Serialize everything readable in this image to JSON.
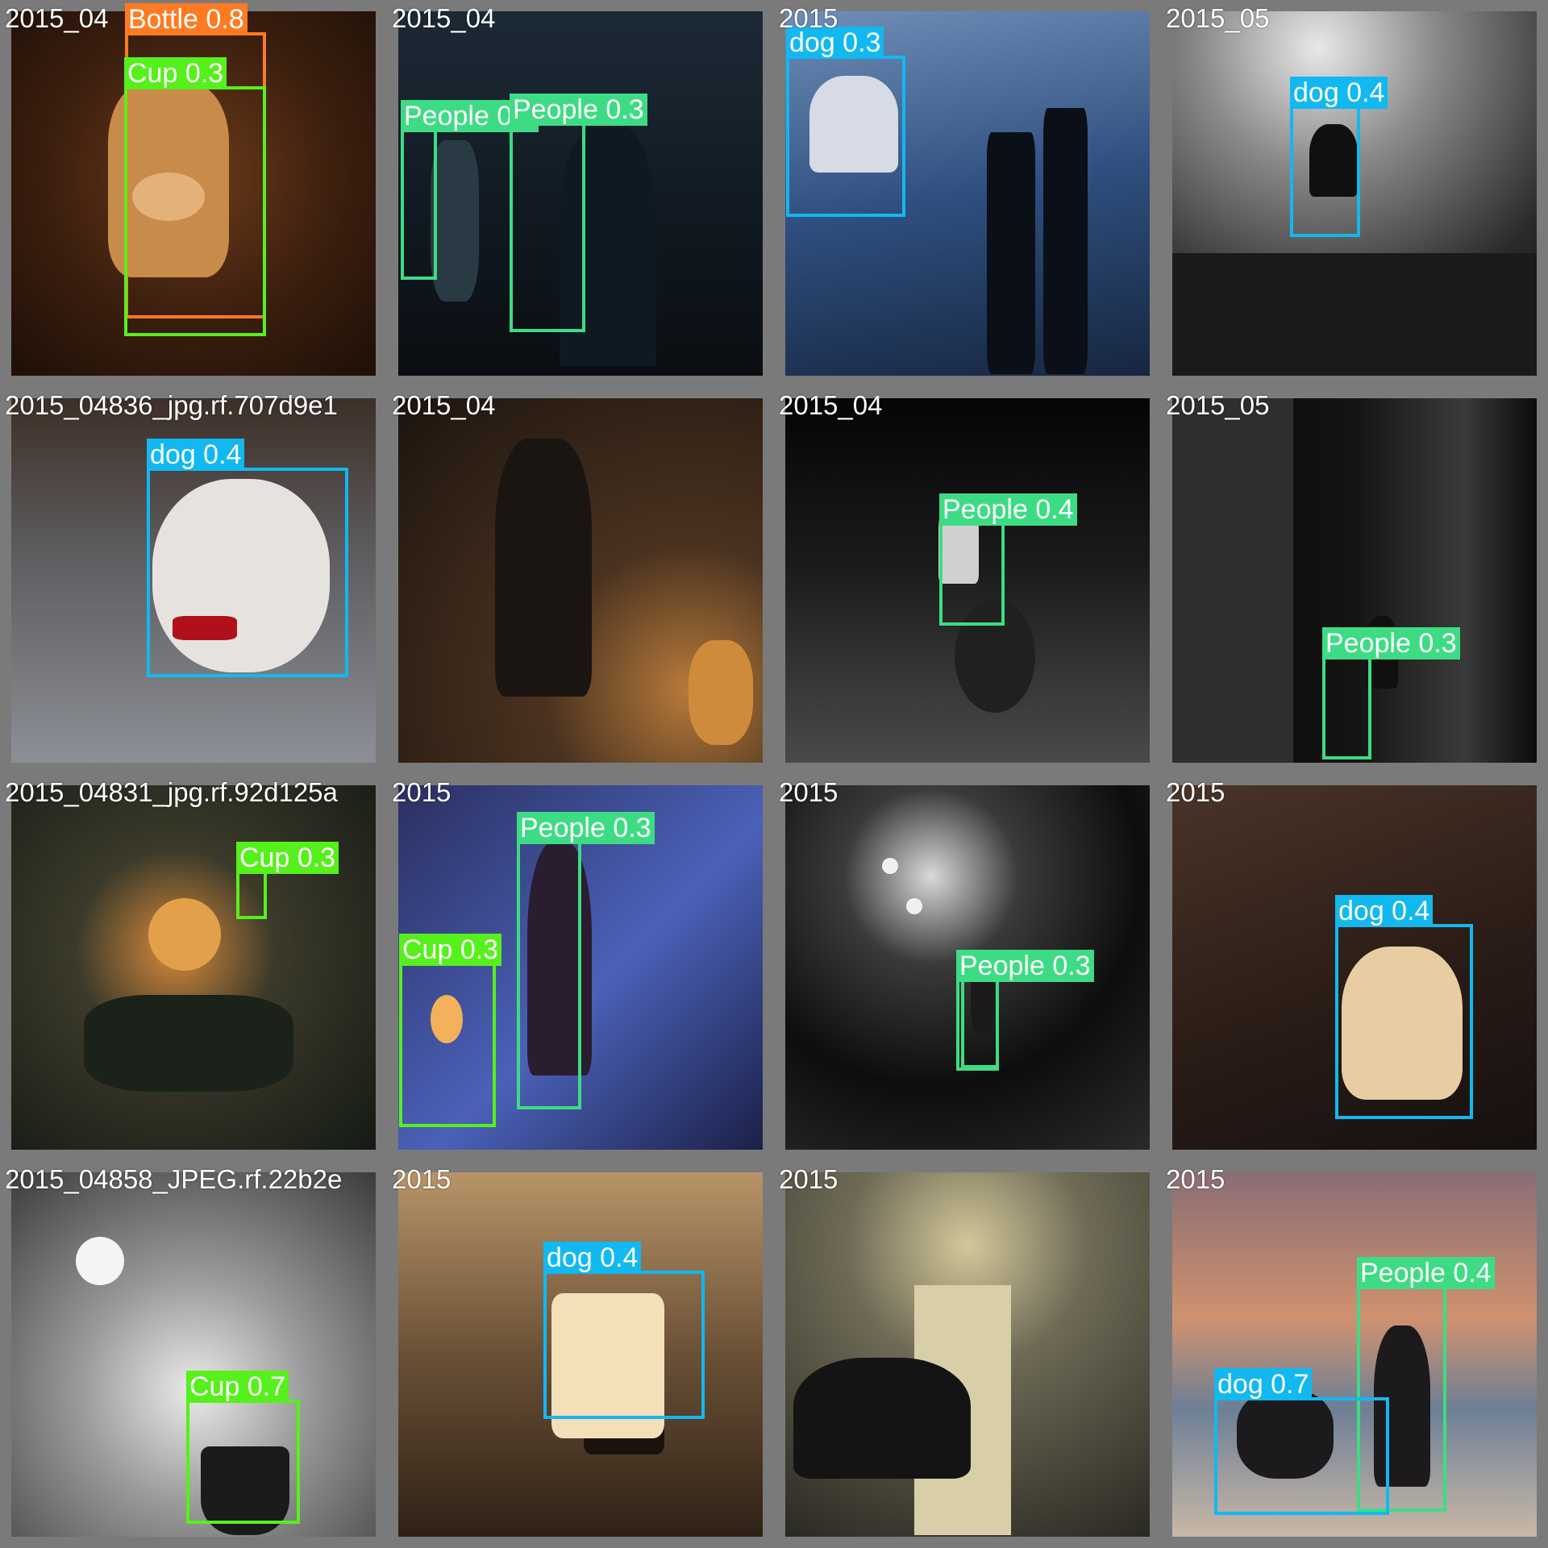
{
  "cells": [
    {
      "filename": "2015_04",
      "detections": [
        {
          "label": "Bottle 0.8",
          "cls": "bottle"
        },
        {
          "label": "Cup 0.3",
          "cls": "cup"
        }
      ]
    },
    {
      "filename": "2015_04",
      "detections": [
        {
          "label": "People 0.3",
          "cls": "people"
        },
        {
          "label": "People 0.3",
          "cls": "people"
        }
      ]
    },
    {
      "filename": "2015",
      "detections": [
        {
          "label": "dog 0.3",
          "cls": "dog"
        }
      ]
    },
    {
      "filename": "2015_05",
      "detections": [
        {
          "label": "dog 0.4",
          "cls": "dog"
        }
      ]
    },
    {
      "filename": "2015_04836_jpg.rf.707d9e1",
      "detections": [
        {
          "label": "dog 0.4",
          "cls": "dog"
        }
      ]
    },
    {
      "filename": "2015_04",
      "detections": []
    },
    {
      "filename": "2015_04",
      "detections": [
        {
          "label": "People 0.4",
          "cls": "people"
        }
      ]
    },
    {
      "filename": "2015_05",
      "detections": [
        {
          "label": "People 0.3",
          "cls": "people"
        }
      ]
    },
    {
      "filename": "2015_04831_jpg.rf.92d125a",
      "detections": [
        {
          "label": "Cup 0.3",
          "cls": "cup"
        }
      ]
    },
    {
      "filename": "2015",
      "detections": [
        {
          "label": "People 0.3",
          "cls": "people"
        },
        {
          "label": "Cup 0.3",
          "cls": "cup"
        }
      ]
    },
    {
      "filename": "2015",
      "detections": [
        {
          "label": "People 0.3",
          "cls": "people"
        },
        {
          "label": "",
          "cls": "people"
        }
      ]
    },
    {
      "filename": "2015",
      "detections": [
        {
          "label": "dog 0.4",
          "cls": "dog"
        }
      ]
    },
    {
      "filename": "2015_04858_JPEG.rf.22b2e",
      "detections": [
        {
          "label": "Cup 0.7",
          "cls": "cup"
        }
      ]
    },
    {
      "filename": "2015",
      "detections": [
        {
          "label": "dog 0.4",
          "cls": "dog"
        }
      ]
    },
    {
      "filename": "2015",
      "detections": []
    },
    {
      "filename": "2015",
      "detections": [
        {
          "label": "People 0.4",
          "cls": "people"
        },
        {
          "label": "dog 0.7",
          "cls": "dog"
        }
      ]
    }
  ]
}
